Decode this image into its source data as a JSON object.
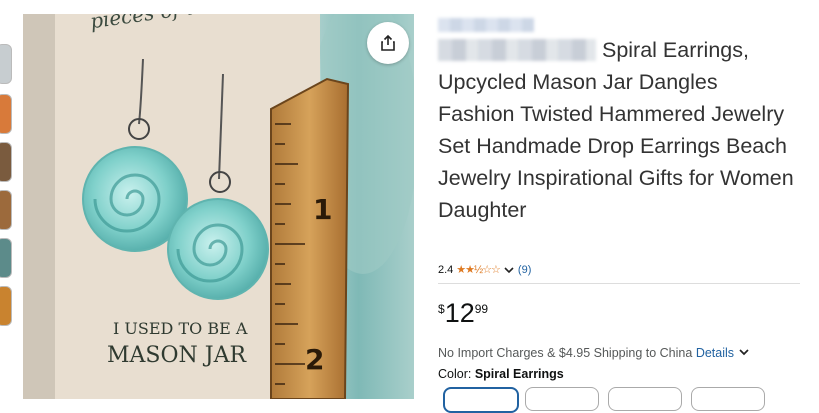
{
  "thumbnails": [
    {
      "name": "thumbnail-1",
      "color": "#c7cdd0"
    },
    {
      "name": "thumbnail-2",
      "color": "#d87a3a"
    },
    {
      "name": "thumbnail-3",
      "color": "#7a5b3e"
    },
    {
      "name": "thumbnail-4",
      "color": "#9c6a3c"
    },
    {
      "name": "thumbnail-5",
      "color": "#5c8b8a"
    },
    {
      "name": "thumbnail-6",
      "color": "#c9832f"
    }
  ],
  "image": {
    "card_text_top": "pieces of the past",
    "card_text_mid": "I USED TO BE A",
    "card_text_bottom": "MASON JAR",
    "ruler_1": "1",
    "ruler_2": "2",
    "share_icon": "share-icon"
  },
  "product": {
    "title": "Spiral Earrings, Upcycled Mason Jar Dangles Fashion Twisted Hammered Jewelry Set Handmade Drop Earrings Beach Jewelry Inspirational Gifts for Women Daughter",
    "rating_value": "2.4",
    "stars": "★★½☆☆",
    "rating_fraction": 0.48,
    "review_count": "(9)",
    "price_symbol": "$",
    "price_whole": "12",
    "price_cents": "99",
    "shipping_text": "No Import Charges & $4.95 Shipping to China",
    "details_link": "Details",
    "color_label": "Color:",
    "color_value": "Spiral Earrings"
  },
  "colors": {
    "link": "#2162a1",
    "star": "#de7921",
    "selected_border": "#2162a1"
  }
}
